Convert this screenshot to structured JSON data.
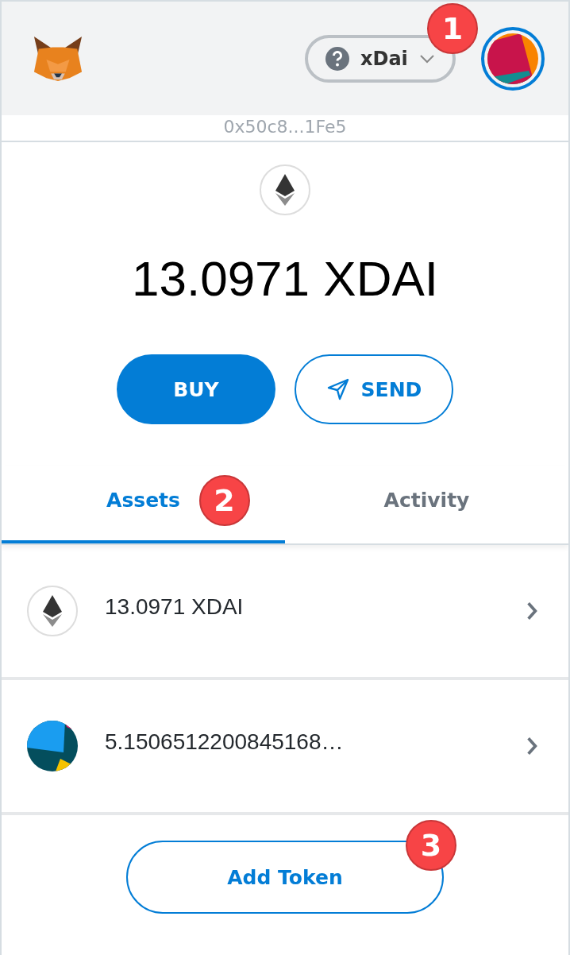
{
  "header": {
    "network": {
      "label": "xDai",
      "badge": "1"
    }
  },
  "account": {
    "address": "0x50c8...1Fe5"
  },
  "balance": {
    "amount": "13.0971 XDAI"
  },
  "actions": [
    {
      "label": "BUY",
      "kind": "filled"
    },
    {
      "label": "SEND",
      "kind": "outlined"
    }
  ],
  "tabs": [
    {
      "label": "Assets",
      "selected": true,
      "badge": "2"
    },
    {
      "label": "Activity",
      "selected": false
    }
  ],
  "assets": [
    {
      "amount": "13.0971 XDAI",
      "kind": "eth"
    },
    {
      "amount": "5.1506512200845168…",
      "kind": "token"
    }
  ],
  "add_token": {
    "label": "Add Token",
    "badge": "3"
  }
}
